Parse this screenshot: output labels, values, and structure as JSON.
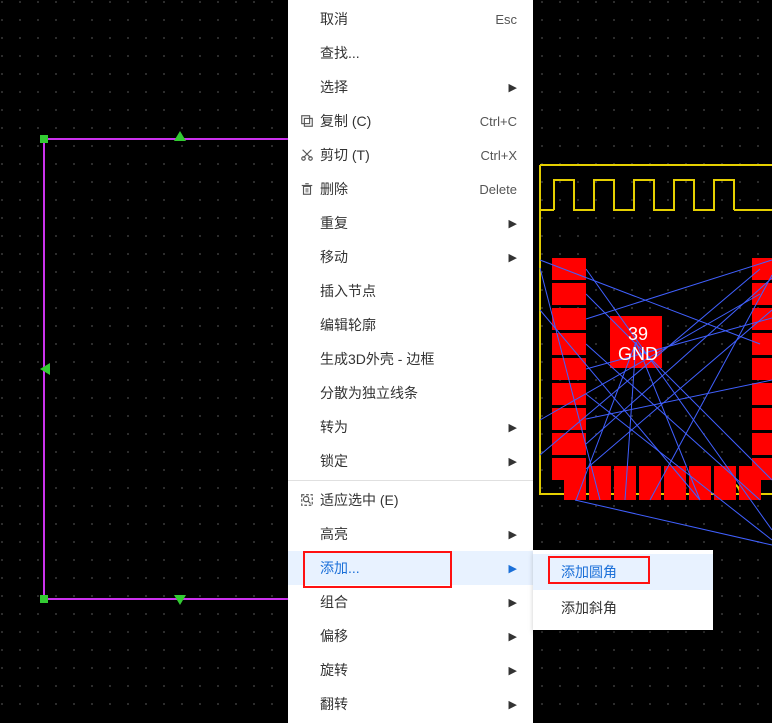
{
  "menu": {
    "items": [
      {
        "label": "取消",
        "shortcut": "Esc",
        "icon": "",
        "arrow": false
      },
      {
        "label": "查找...",
        "shortcut": "",
        "icon": "",
        "arrow": false
      },
      {
        "label": "选择",
        "shortcut": "",
        "icon": "",
        "arrow": true
      },
      {
        "label": "复制 (C)",
        "shortcut": "Ctrl+C",
        "icon": "copy",
        "arrow": false
      },
      {
        "label": "剪切 (T)",
        "shortcut": "Ctrl+X",
        "icon": "cut",
        "arrow": false
      },
      {
        "label": "删除",
        "shortcut": "Delete",
        "icon": "delete",
        "arrow": false
      },
      {
        "label": "重复",
        "shortcut": "",
        "icon": "",
        "arrow": true
      },
      {
        "label": "移动",
        "shortcut": "",
        "icon": "",
        "arrow": true
      },
      {
        "label": "插入节点",
        "shortcut": "",
        "icon": "",
        "arrow": false
      },
      {
        "label": "编辑轮廓",
        "shortcut": "",
        "icon": "",
        "arrow": false
      },
      {
        "label": "生成3D外壳 - 边框",
        "shortcut": "",
        "icon": "",
        "arrow": false
      },
      {
        "label": "分散为独立线条",
        "shortcut": "",
        "icon": "",
        "arrow": false
      },
      {
        "label": "转为",
        "shortcut": "",
        "icon": "",
        "arrow": true
      },
      {
        "label": "锁定",
        "shortcut": "",
        "icon": "",
        "arrow": true
      },
      {
        "sep": true
      },
      {
        "label": "适应选中 (E)",
        "shortcut": "",
        "icon": "fit",
        "arrow": false
      },
      {
        "label": "高亮",
        "shortcut": "",
        "icon": "",
        "arrow": true
      },
      {
        "label": "添加...",
        "shortcut": "",
        "icon": "",
        "arrow": true,
        "highlight": true
      },
      {
        "label": "组合",
        "shortcut": "",
        "icon": "",
        "arrow": true
      },
      {
        "label": "偏移",
        "shortcut": "",
        "icon": "",
        "arrow": true
      },
      {
        "label": "旋转",
        "shortcut": "",
        "icon": "",
        "arrow": true
      },
      {
        "label": "翻转",
        "shortcut": "",
        "icon": "",
        "arrow": true
      }
    ]
  },
  "submenu": {
    "items": [
      {
        "label": "添加圆角",
        "highlight": true
      },
      {
        "label": "添加斜角",
        "highlight": false
      }
    ]
  },
  "pcb": {
    "pin_number": "39",
    "pin_net": "GND"
  },
  "colors": {
    "bg": "#000000",
    "grid": "#3a3a3a",
    "outline": "#cc33ee",
    "handle_fill": "#33cc33",
    "silkscreen": "#e6d000",
    "copper": "#ff0000",
    "ratsnest": "#4060ff",
    "highlight_menu": "#e8f2ff",
    "highlight_text": "#1a6fd8",
    "redbox": "#ff1111"
  }
}
